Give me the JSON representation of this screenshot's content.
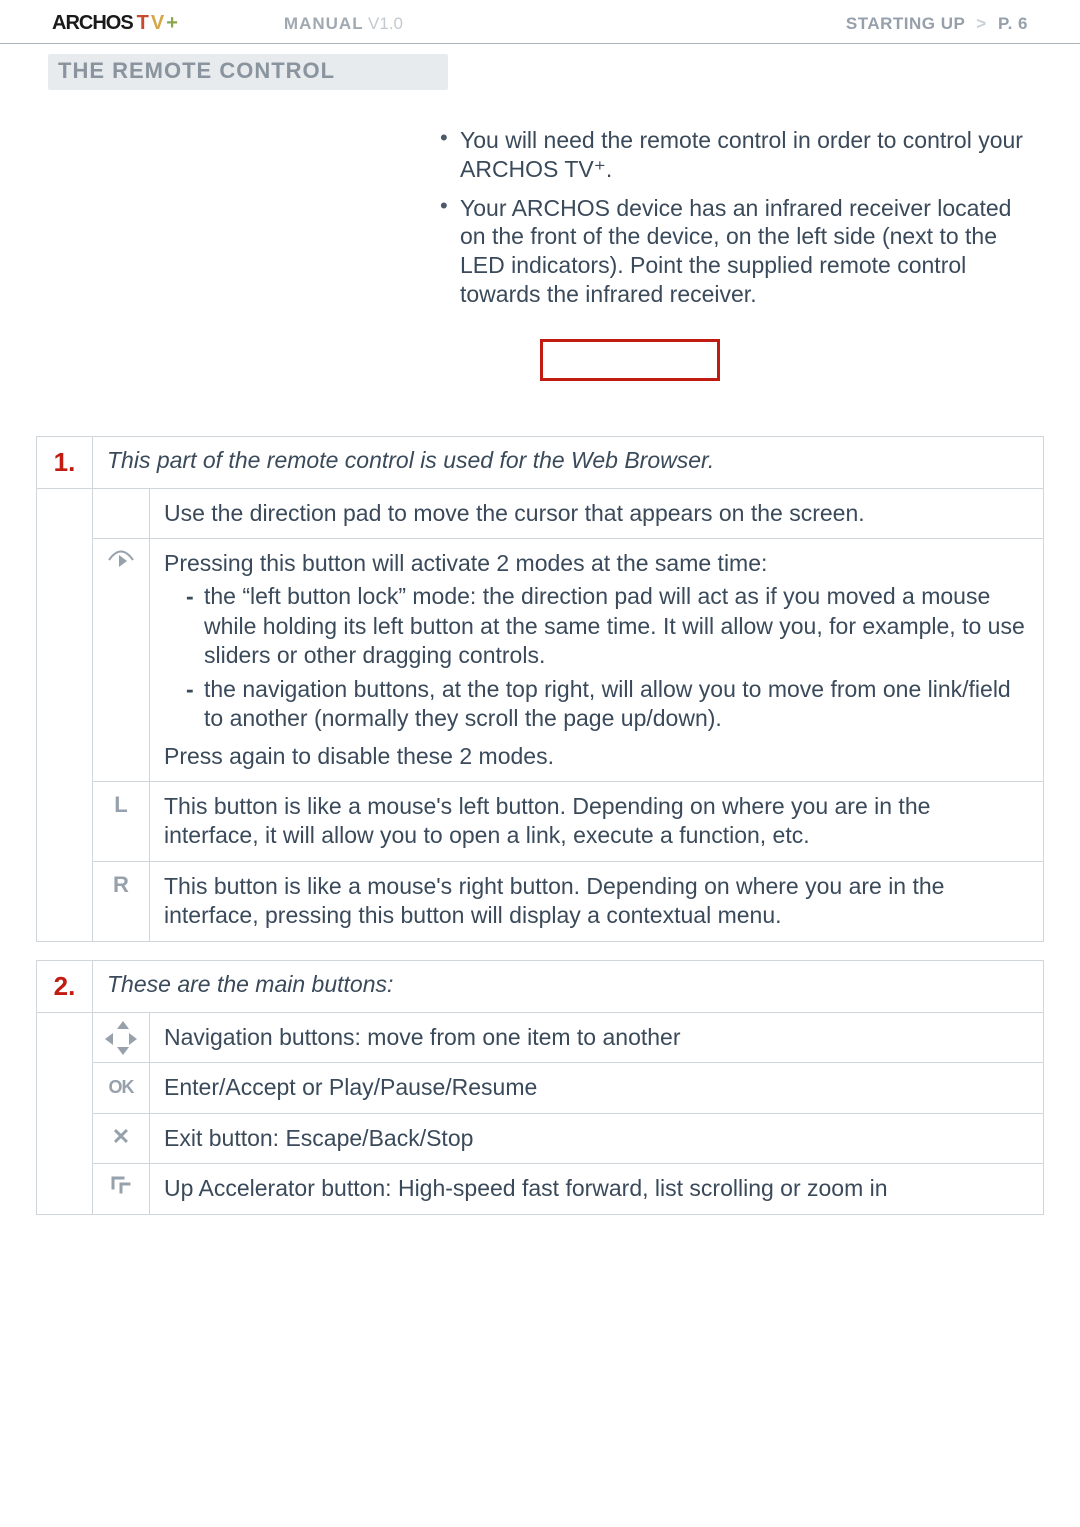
{
  "header": {
    "logo_archos": "ARCHOS",
    "logo_t": "T",
    "logo_v": "V",
    "logo_plus": "+",
    "manual_label": "MANUAL",
    "manual_version": "V1.0",
    "starting_up": "STARTING UP",
    "page_label": "P. 6"
  },
  "section_title": "THE REMOTE CONTROL",
  "intro": {
    "bullet1": "You will need the remote control in order to control your ARCHOS TV⁺.",
    "bullet2": "Your ARCHOS device has an infrared receiver located on the front of the device, on the left side (next to the LED indicators). Point the supplied remote control towards the infrared receiver."
  },
  "section1": {
    "num": "1.",
    "title": "This part of the remote control is used for the Web Browser.",
    "rows": [
      {
        "icon_name": "direction-pad-blank",
        "text_parts": {
          "main": "Use the direction pad to move the cursor that appears on the screen."
        }
      },
      {
        "icon_name": "cursor-mode-icon",
        "text_parts": {
          "lead": "Pressing this button will activate 2 modes at the same time:",
          "li1": "the “left button lock” mode: the direction pad will act as if you moved a mouse while holding its left button at the same time. It will allow you, for example, to use sliders or other dragging controls.",
          "li2": "the navigation buttons, at the top right, will allow you to move from one link/field to another (normally they scroll the page up/down).",
          "trail": "Press again to disable these 2 modes."
        }
      },
      {
        "icon_name": "L-button",
        "icon_text": "L",
        "text_parts": {
          "main": "This button is like a mouse's left button. Depending on where you are in the interface, it will allow you to open a link, execute a function, etc."
        }
      },
      {
        "icon_name": "R-button",
        "icon_text": "R",
        "text_parts": {
          "main": "This button is like a mouse's right button. Depending on where you are in the interface, pressing this button will display a contextual menu."
        }
      }
    ]
  },
  "section2": {
    "num": "2.",
    "title": "These are the main buttons:",
    "rows": [
      {
        "icon_name": "nav-dpad-icon",
        "text": "Navigation buttons: move from one item to another"
      },
      {
        "icon_name": "ok-icon",
        "icon_text": "OK",
        "text": "Enter/Accept or Play/Pause/Resume"
      },
      {
        "icon_name": "x-icon",
        "icon_text": "✕",
        "text": "Exit button: Escape/Back/Stop"
      },
      {
        "icon_name": "up-accelerator-icon",
        "text": "Up Accelerator button: High-speed fast forward, list scrolling or zoom in"
      }
    ]
  }
}
